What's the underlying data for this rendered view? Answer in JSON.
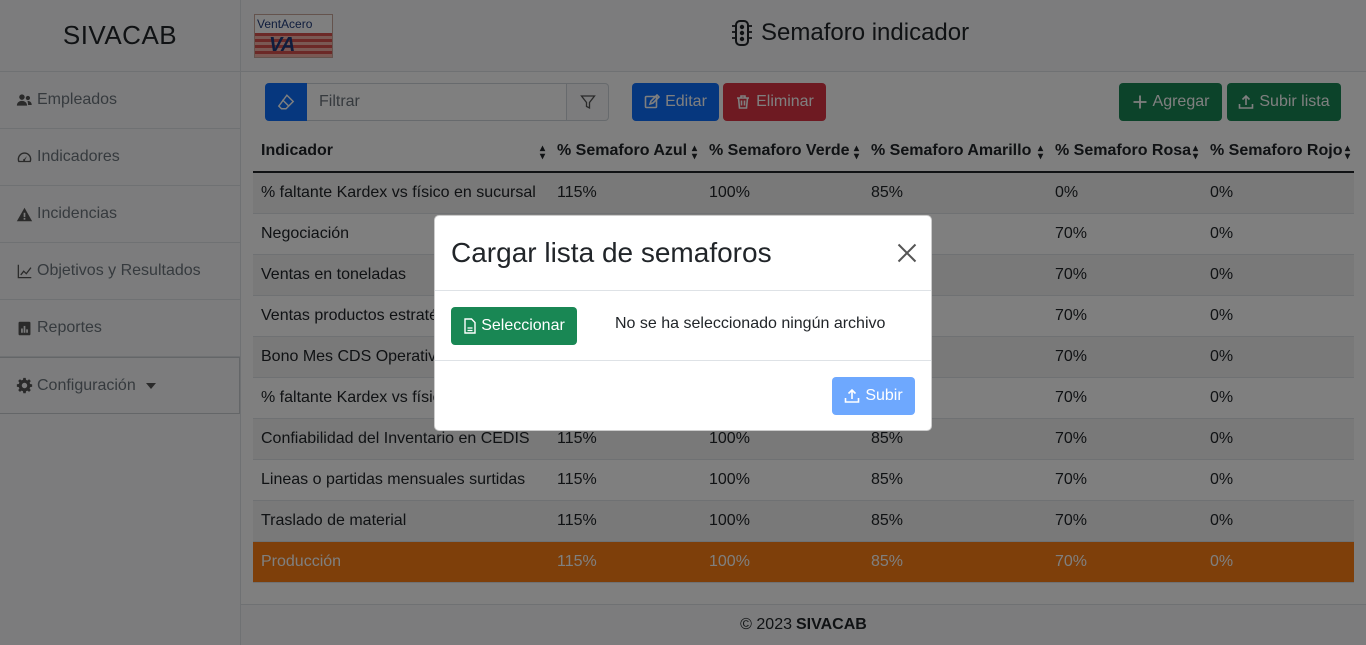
{
  "app": {
    "brand": "SIVACAB",
    "page_title": "Semaforo indicador",
    "logo_text": "VentAcero",
    "logo_sub": "VA"
  },
  "sidebar": {
    "items": [
      {
        "label": "Empleados",
        "icon": "users-icon"
      },
      {
        "label": "Indicadores",
        "icon": "gauge-icon"
      },
      {
        "label": "Incidencias",
        "icon": "warning-icon"
      },
      {
        "label": "Objetivos y Resultados",
        "icon": "chart-line-icon"
      },
      {
        "label": "Reportes",
        "icon": "report-icon"
      },
      {
        "label": "Configuración",
        "icon": "gear-icon"
      }
    ]
  },
  "toolbar": {
    "filter_placeholder": "Filtrar",
    "edit_label": "Editar",
    "delete_label": "Eliminar",
    "add_label": "Agregar",
    "upload_list_label": "Subir lista"
  },
  "table": {
    "headers": [
      "Indicador",
      "% Semaforo Azul",
      "% Semaforo Verde",
      "% Semaforo Amarillo",
      "% Semaforo Rosa",
      "% Semaforo Rojo"
    ],
    "rows": [
      [
        "% faltante Kardex vs físico en sucursal",
        "115%",
        "100%",
        "85%",
        "0%",
        "0%"
      ],
      [
        "Negociación",
        "",
        "",
        "",
        "70%",
        "0%"
      ],
      [
        "Ventas en toneladas",
        "",
        "",
        "",
        "70%",
        "0%"
      ],
      [
        "Ventas productos estraté",
        "",
        "",
        "",
        "70%",
        "0%"
      ],
      [
        "Bono Mes CDS Operativo",
        "",
        "",
        "",
        "70%",
        "0%"
      ],
      [
        "% faltante Kardex vs físic",
        "",
        "",
        "",
        "70%",
        "0%"
      ],
      [
        "Confiabilidad del Inventario en CEDIS",
        "115%",
        "100%",
        "85%",
        "70%",
        "0%"
      ],
      [
        "Lineas o partidas mensuales surtidas",
        "115%",
        "100%",
        "85%",
        "70%",
        "0%"
      ],
      [
        "Traslado de material",
        "115%",
        "100%",
        "85%",
        "70%",
        "0%"
      ],
      [
        "Producción",
        "115%",
        "100%",
        "85%",
        "70%",
        "0%"
      ]
    ],
    "selected_index": 9
  },
  "footer": {
    "copyright": "© 2023",
    "brand": "SIVACAB"
  },
  "modal": {
    "title": "Cargar lista de semaforos",
    "select_label": "Seleccionar",
    "file_status": "No se ha seleccionado ningún archivo",
    "submit_label": "Subir"
  },
  "colors": {
    "primary": "#0d6efd",
    "danger": "#dc3545",
    "success": "#198754",
    "selected_row": "#fd7e14",
    "submit_disabled": "#6ea8fe"
  }
}
